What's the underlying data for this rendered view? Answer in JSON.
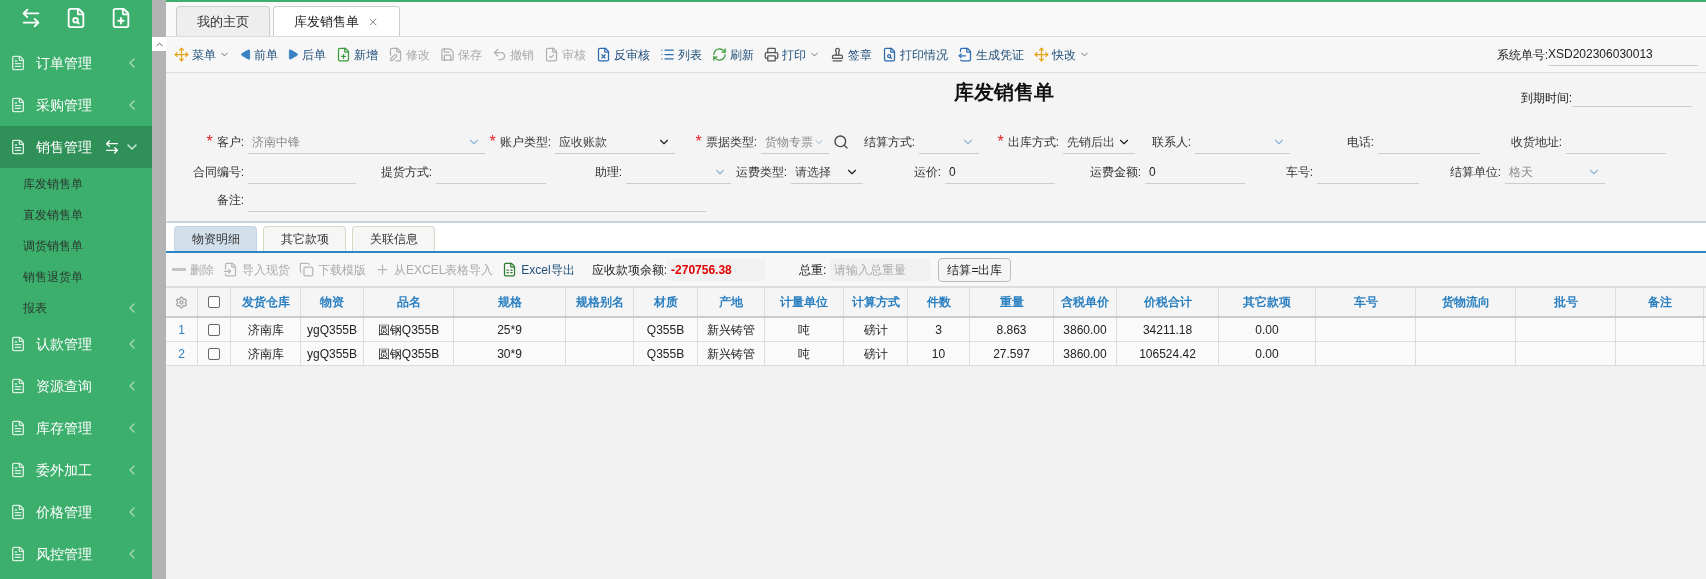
{
  "sidebar": {
    "items": [
      {
        "label": "订单管理",
        "selected": false,
        "expanded": false
      },
      {
        "label": "采购管理",
        "selected": false,
        "expanded": false
      },
      {
        "label": "销售管理",
        "selected": true,
        "expanded": true,
        "children": [
          {
            "label": "库发销售单",
            "expandable": false
          },
          {
            "label": "直发销售单",
            "expandable": false
          },
          {
            "label": "调货销售单",
            "expandable": false
          },
          {
            "label": "销售退货单",
            "expandable": false
          },
          {
            "label": "报表",
            "expandable": true
          }
        ]
      },
      {
        "label": "认款管理",
        "selected": false,
        "expanded": false
      },
      {
        "label": "资源查询",
        "selected": false,
        "expanded": false
      },
      {
        "label": "库存管理",
        "selected": false,
        "expanded": false
      },
      {
        "label": "委外加工",
        "selected": false,
        "expanded": false
      },
      {
        "label": "价格管理",
        "selected": false,
        "expanded": false
      },
      {
        "label": "风控管理",
        "selected": false,
        "expanded": false
      }
    ]
  },
  "tabs": [
    {
      "label": "我的主页",
      "selected": false,
      "closable": false
    },
    {
      "label": "库发销售单",
      "selected": true,
      "closable": true
    }
  ],
  "toolbar": [
    {
      "label": "菜单",
      "disabled": false,
      "has_menu": true
    },
    {
      "label": "前单",
      "disabled": false,
      "has_menu": false
    },
    {
      "label": "后单",
      "disabled": false,
      "has_menu": false
    },
    {
      "label": "新增",
      "disabled": false,
      "has_menu": false
    },
    {
      "label": "修改",
      "disabled": true,
      "has_menu": false
    },
    {
      "label": "保存",
      "disabled": true,
      "has_menu": false
    },
    {
      "label": "撤销",
      "disabled": true,
      "has_menu": false
    },
    {
      "label": "审核",
      "disabled": true,
      "has_menu": false
    },
    {
      "label": "反审核",
      "disabled": false,
      "has_menu": false
    },
    {
      "label": "列表",
      "disabled": false,
      "has_menu": false
    },
    {
      "label": "刷新",
      "disabled": false,
      "has_menu": false
    },
    {
      "label": "打印",
      "disabled": false,
      "has_menu": true
    },
    {
      "label": "签章",
      "disabled": false,
      "has_menu": false
    },
    {
      "label": "打印情况",
      "disabled": false,
      "has_menu": false
    },
    {
      "label": "生成凭证",
      "disabled": false,
      "has_menu": false
    },
    {
      "label": "快改",
      "disabled": false,
      "has_menu": true
    }
  ],
  "system_no": {
    "label": "系统单号:",
    "value": "XSD202306030013"
  },
  "form": {
    "title": "库发销售单",
    "due": {
      "label": "到期时间:"
    },
    "fields": [
      {
        "kind": "combo",
        "required_mark": "*",
        "label": "客户:",
        "value": "济南中锋",
        "disabled": true
      },
      {
        "kind": "select",
        "required_mark": "*",
        "label": "账户类型:",
        "value": "应收账款"
      },
      {
        "kind": "combo",
        "required_mark": "*",
        "label": "票据类型:",
        "value": "货物专票",
        "disabled": true,
        "lookup": true
      },
      {
        "kind": "combo",
        "label": "结算方式:"
      },
      {
        "kind": "select",
        "required_mark": "*",
        "label": "出库方式:",
        "value": "先销后出"
      },
      {
        "kind": "combo",
        "label": "联系人:"
      },
      {
        "kind": "text",
        "label": "电话:"
      },
      {
        "kind": "text",
        "label": "收货地址:"
      },
      {
        "kind": "text",
        "label": "合同编号:"
      },
      {
        "kind": "text",
        "label": "提货方式:"
      },
      {
        "kind": "combo",
        "label": "助理:"
      },
      {
        "kind": "select",
        "label": "运费类型:",
        "value": "请选择"
      },
      {
        "kind": "text",
        "label": "运价:",
        "value": "0"
      },
      {
        "kind": "text",
        "label": "运费金额:",
        "value": "0"
      },
      {
        "kind": "text",
        "label": "车号:"
      },
      {
        "kind": "combo",
        "label": "结算单位:",
        "value": "格天",
        "disabled": true
      },
      {
        "kind": "text",
        "label": "备注:"
      }
    ]
  },
  "subtabs": [
    {
      "label": "物资明细",
      "selected": true
    },
    {
      "label": "其它款项",
      "selected": false
    },
    {
      "label": "关联信息",
      "selected": false
    }
  ],
  "detail_toolbar": {
    "buttons": [
      {
        "label": "删除",
        "disabled": true
      },
      {
        "label": "导入现货",
        "disabled": true
      },
      {
        "label": "下载模版",
        "disabled": true
      },
      {
        "label": "从EXCEL表格导入",
        "disabled": true
      },
      {
        "label": "Excel导出",
        "disabled": false
      }
    ],
    "balance": {
      "label": "应收款项余额:",
      "value": "-270756.38"
    },
    "weight": {
      "label": "总重:",
      "placeholder": "请输入总重量"
    },
    "settle": "结算=出库"
  },
  "table": {
    "all_checked": false,
    "columns": [
      "发货仓库",
      "物资",
      "品名",
      "规格",
      "规格别名",
      "材质",
      "产地",
      "计量单位",
      "计算方式",
      "件数",
      "重量",
      "含税单价",
      "价税合计",
      "其它款项",
      "车号",
      "货物流向",
      "批号",
      "备注"
    ],
    "rows": [
      {
        "index": "1",
        "checked": false,
        "cells": [
          "济南库",
          "ygQ355B",
          "圆钢Q355B",
          "25*9",
          null,
          "Q355B",
          "新兴铸管",
          "吨",
          "磅计",
          "3",
          "8.863",
          "3860.00",
          "34211.18",
          "0.00",
          null,
          null,
          null,
          null
        ]
      },
      {
        "index": "2",
        "checked": false,
        "cells": [
          "济南库",
          "ygQ355B",
          "圆钢Q355B",
          "30*9",
          null,
          "Q355B",
          "新兴铸管",
          "吨",
          "磅计",
          "10",
          "27.597",
          "3860.00",
          "106524.42",
          "0.00",
          null,
          null,
          null,
          null
        ]
      }
    ]
  }
}
